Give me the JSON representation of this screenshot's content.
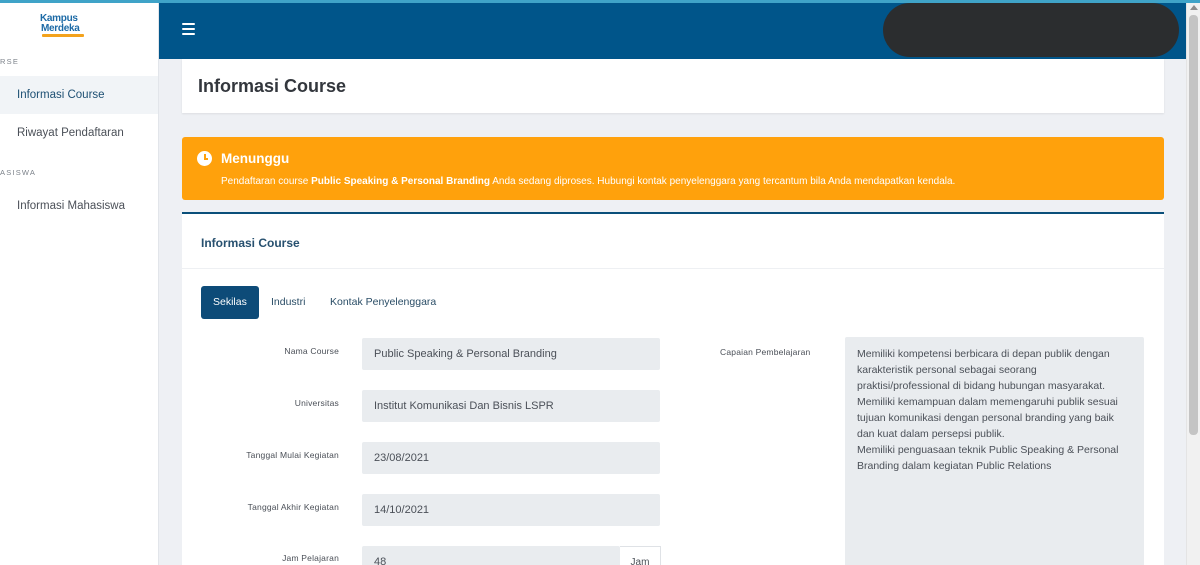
{
  "sidebar": {
    "logo": {
      "line1": "Kampus",
      "line2": "Merdeka"
    },
    "section1": "RSE",
    "section2": "ASISWA",
    "items": [
      {
        "label": "Informasi Course",
        "active": true
      },
      {
        "label": "Riwayat Pendaftaran",
        "active": false
      },
      {
        "label": "Informasi Mahasiswa",
        "active": false
      }
    ]
  },
  "header": {
    "menu_icon": "hamburger-icon",
    "bg_color": "#00558a"
  },
  "page": {
    "title": "Informasi Course"
  },
  "alert": {
    "title": "Menunggu",
    "icon": "clock-icon",
    "msg_prefix": "Pendaftaran course ",
    "msg_course": "Public Speaking & Personal Branding",
    "msg_suffix": " Anda sedang diproses. Hubungi kontak penyelenggara yang tercantum bila Anda mendapatkan kendala.",
    "color": "#ffa10c"
  },
  "info": {
    "heading": "Informasi Course",
    "tabs": [
      {
        "label": "Sekilas",
        "active": true
      },
      {
        "label": "Industri",
        "active": false
      },
      {
        "label": "Kontak Penyelenggara",
        "active": false
      }
    ],
    "fields": {
      "nama_course": {
        "label": "Nama Course",
        "value": "Public Speaking & Personal Branding"
      },
      "universitas": {
        "label": "Universitas",
        "value": "Institut Komunikasi Dan Bisnis LSPR"
      },
      "tanggal_mulai": {
        "label": "Tanggal Mulai Kegiatan",
        "value": "23/08/2021"
      },
      "tanggal_akhir": {
        "label": "Tanggal Akhir Kegiatan",
        "value": "14/10/2021"
      },
      "jam_pelajaran": {
        "label": "Jam Pelajaran",
        "value": "48",
        "unit": "Jam"
      }
    },
    "capaian": {
      "label": "Capaian Pembelajaran",
      "lines": [
        "Memiliki kompetensi berbicara di depan publik dengan karakteristik personal sebagai seorang praktisi/professional di bidang hubungan masyarakat.",
        "Memiliki kemampuan dalam memengaruhi publik sesuai tujuan komunikasi dengan personal branding yang baik dan kuat dalam persepsi publik.",
        "Memiliki penguasaan teknik Public Speaking & Personal Branding dalam kegiatan Public Relations"
      ]
    }
  }
}
